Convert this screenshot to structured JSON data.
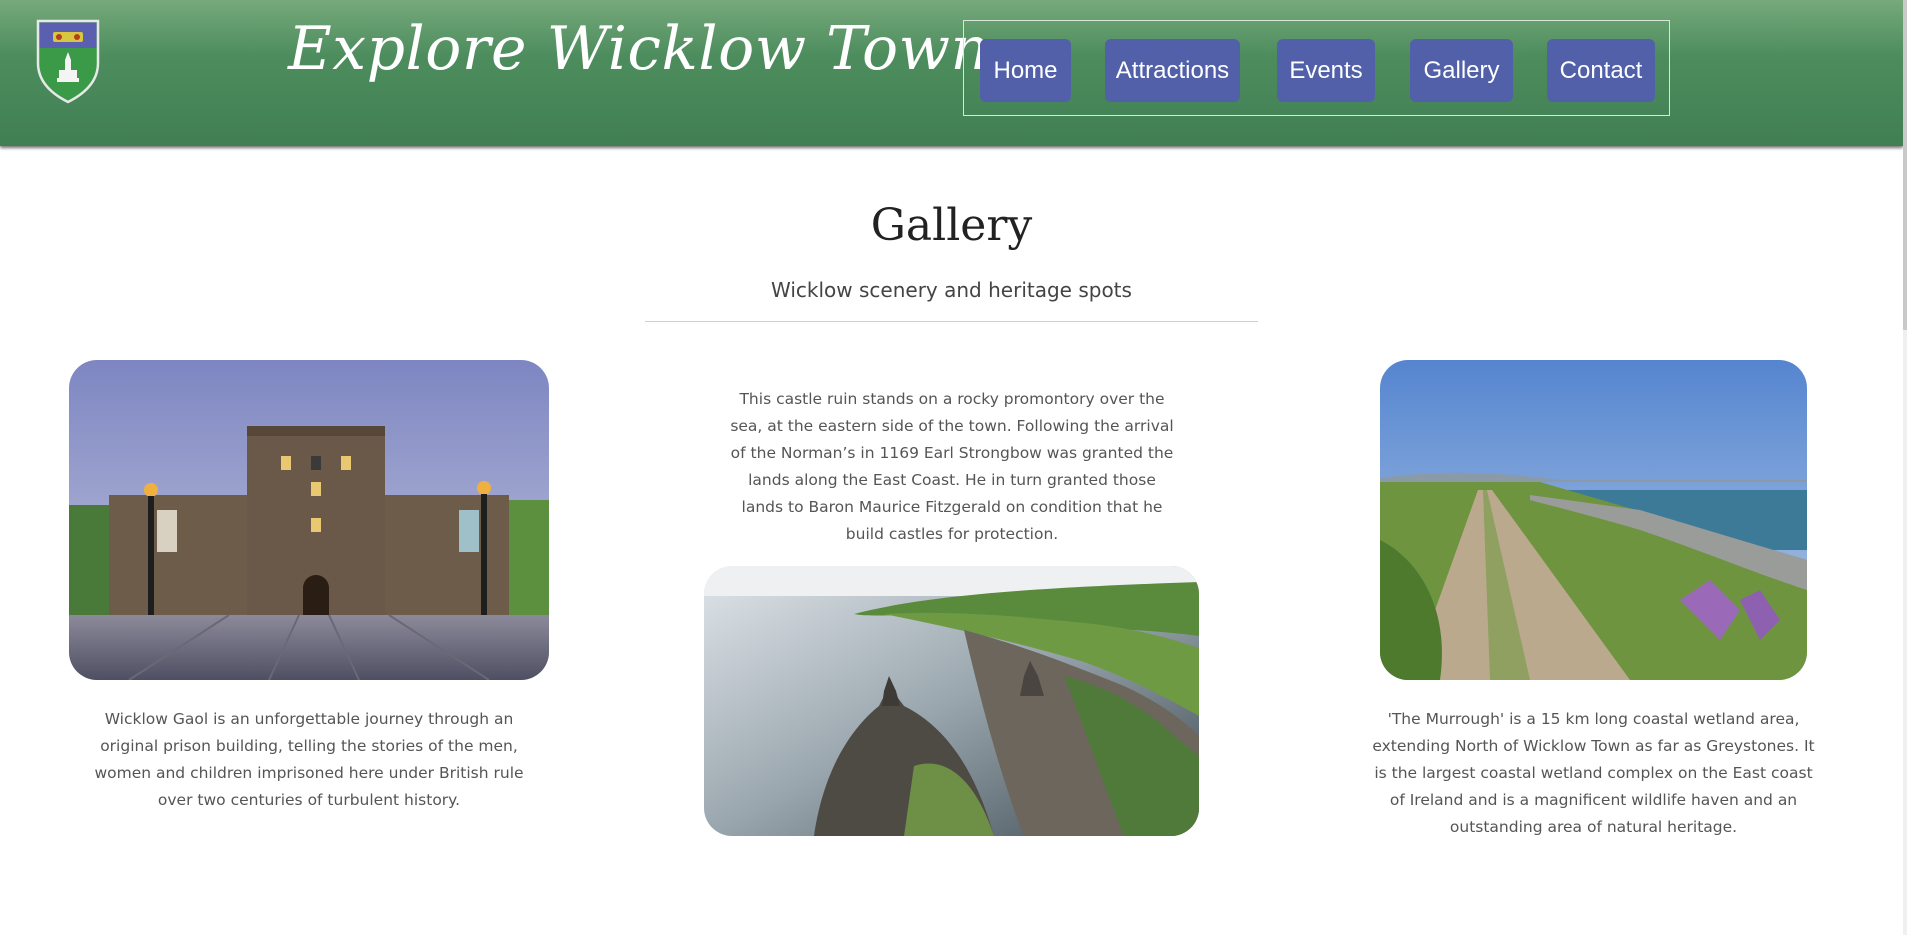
{
  "header": {
    "site_title": "Explore Wicklow Town",
    "logo_icon": "crest-icon",
    "nav": [
      {
        "label": "Home"
      },
      {
        "label": "Attractions"
      },
      {
        "label": "Events"
      },
      {
        "label": "Gallery"
      },
      {
        "label": "Contact"
      }
    ]
  },
  "main": {
    "title": "Gallery",
    "subtitle": "Wicklow scenery and heritage spots",
    "items": [
      {
        "photo": "wicklow-gaol-photo",
        "caption": "Wicklow Gaol is an unforgettable journey through an original prison building, telling the stories of the men, women and children imprisoned here under British rule over two centuries of turbulent history."
      },
      {
        "photo": "castle-ruin-photo",
        "caption": "This castle ruin stands on a rocky promontory over the sea, at the eastern side of the town. Following the arrival of the Norman’s in 1169 Earl Strongbow was granted the lands along the East Coast. He in turn granted those lands to Baron Maurice Fitzgerald on condition that he build castles for protection."
      },
      {
        "photo": "murrough-path-photo",
        "caption": "'The Murrough' is a 15 km long coastal wetland area, extending North of Wicklow Town as far as Greystones. It is the largest coastal wetland complex on the East coast of Ireland and is a magnificent wildlife haven and an outstanding area of natural heritage."
      }
    ]
  },
  "colors": {
    "header_green": "#4d8d5d",
    "nav_button": "#5160a8",
    "nav_text": "#ffffff"
  }
}
